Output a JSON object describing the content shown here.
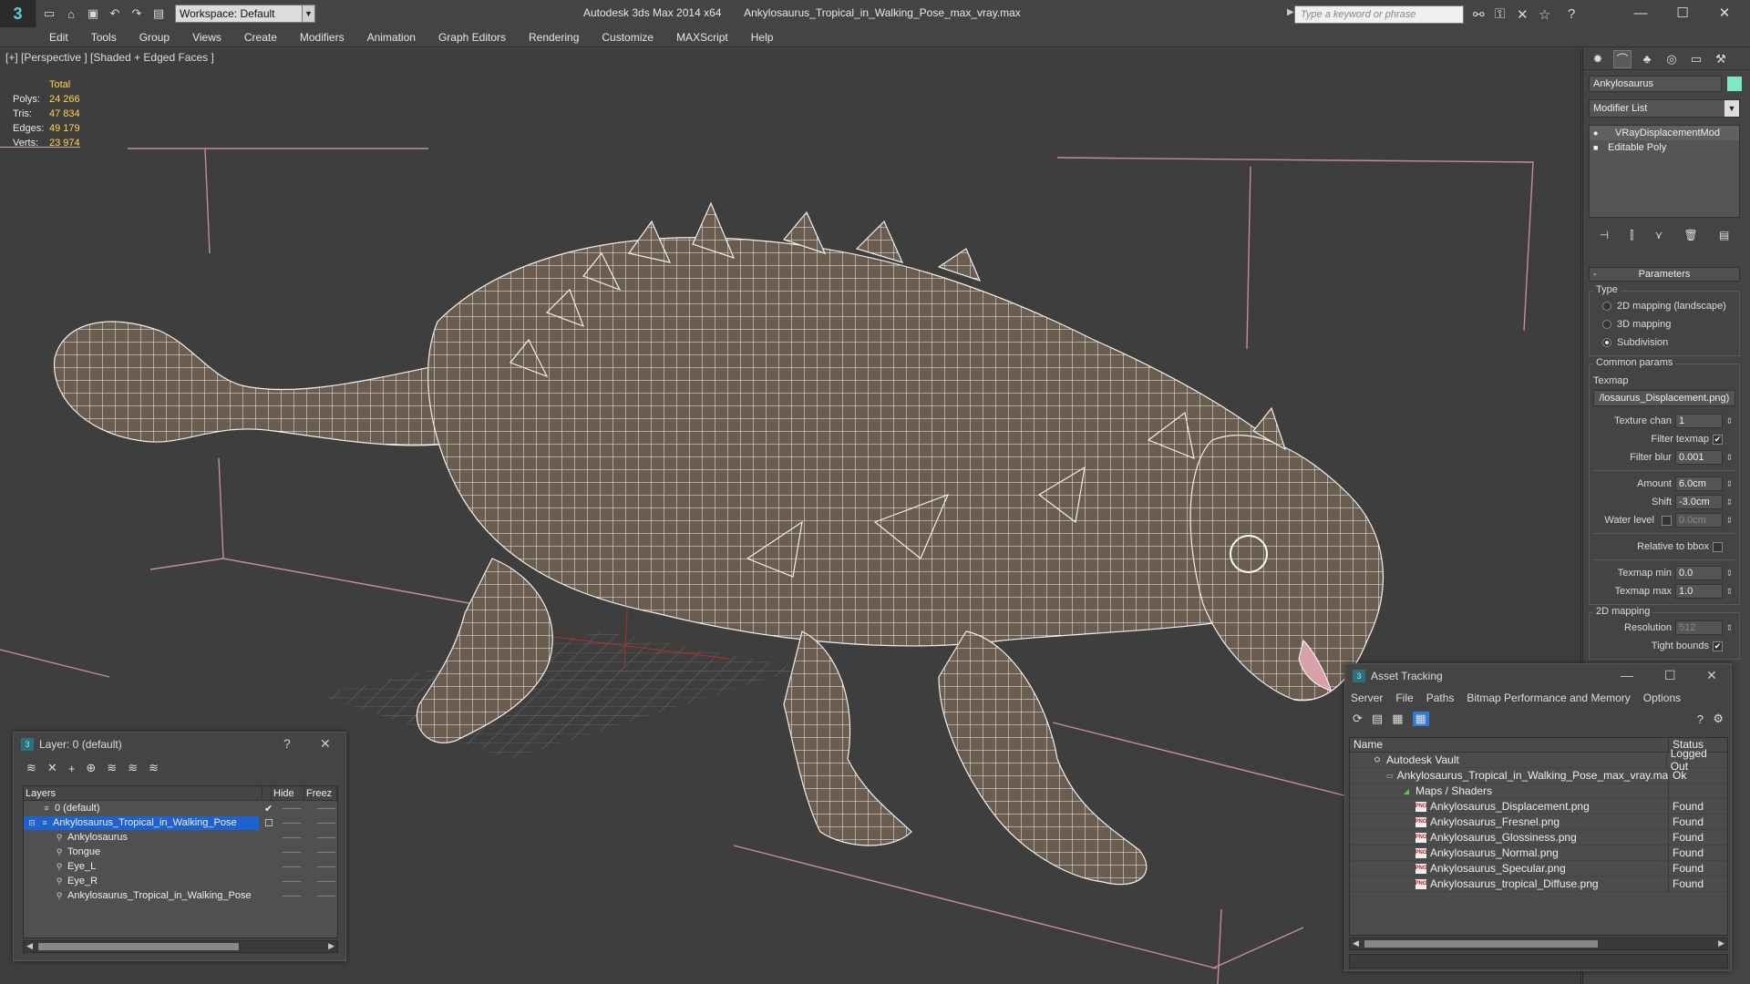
{
  "titlebar": {
    "workspace": "Workspace: Default",
    "app": "Autodesk 3ds Max  2014 x64",
    "file": "Ankylosaurus_Tropical_in_Walking_Pose_max_vray.max",
    "search_placeholder": "Type a keyword or phrase"
  },
  "menu": [
    "Edit",
    "Tools",
    "Group",
    "Views",
    "Create",
    "Modifiers",
    "Animation",
    "Graph Editors",
    "Rendering",
    "Customize",
    "MAXScript",
    "Help"
  ],
  "viewport": {
    "label": "[+] [Perspective ] [Shaded + Edged Faces ]",
    "stats": {
      "total_label": "Total",
      "rows": [
        {
          "k": "Polys:",
          "v": "24 266"
        },
        {
          "k": "Tris:",
          "v": "47 834"
        },
        {
          "k": "Edges:",
          "v": "49 179"
        },
        {
          "k": "Verts:",
          "v": "23 974"
        }
      ]
    }
  },
  "command_panel": {
    "object_name": "Ankylosaurus",
    "object_color": "#7de8c8",
    "modifier_list": "Modifier List",
    "stack": [
      "VRayDisplacementMod",
      "Editable Poly"
    ],
    "parameters_title": "Parameters",
    "type_group": "Type",
    "type_options": [
      "2D mapping (landscape)",
      "3D mapping",
      "Subdivision"
    ],
    "common_group": "Common params",
    "texmap_label": "Texmap",
    "texmap_value": "/losaurus_Displacement.png)",
    "texture_chan_label": "Texture chan",
    "texture_chan": "1",
    "filter_texmap_label": "Filter texmap",
    "filter_blur_label": "Filter blur",
    "filter_blur": "0.001",
    "amount_label": "Amount",
    "amount": "6.0cm",
    "shift_label": "Shift",
    "shift": "-3.0cm",
    "water_level_label": "Water level",
    "water_level": "0.0cm",
    "relative_bbox_label": "Relative to bbox",
    "texmap_min_label": "Texmap min",
    "texmap_min": "0.0",
    "texmap_max_label": "Texmap max",
    "texmap_max": "1.0",
    "mapping_group": "2D mapping",
    "resolution_label": "Resolution",
    "resolution": "512",
    "tight_bounds_label": "Tight bounds"
  },
  "layer_dialog": {
    "title": "Layer: 0 (default)",
    "help": "?",
    "close": "✕",
    "col_layers": "Layers",
    "col_hide": "Hide",
    "col_freeze": "Freez",
    "rows": [
      {
        "name": "0 (default)",
        "indent": 0
      },
      {
        "name": "Ankylosaurus_Tropical_in_Walking_Pose",
        "indent": 0
      },
      {
        "name": "Ankylosaurus",
        "indent": 1
      },
      {
        "name": "Tongue",
        "indent": 1
      },
      {
        "name": "Eye_L",
        "indent": 1
      },
      {
        "name": "Eye_R",
        "indent": 1
      },
      {
        "name": "Ankylosaurus_Tropical_in_Walking_Pose",
        "indent": 1
      }
    ],
    "current_mark": "✔",
    "dash": "——"
  },
  "asset_dialog": {
    "title": "Asset Tracking",
    "menu": [
      "Server",
      "File",
      "Paths",
      "Bitmap Performance and Memory",
      "Options"
    ],
    "col_name": "Name",
    "col_status": "Status",
    "rows": [
      {
        "name": "Autodesk Vault",
        "status": "Logged Out",
        "indent": 1,
        "icon": "vault"
      },
      {
        "name": "Ankylosaurus_Tropical_in_Walking_Pose_max_vray.max",
        "status": "Ok",
        "indent": 2,
        "icon": "doc"
      },
      {
        "name": "Maps / Shaders",
        "status": "",
        "indent": 3,
        "icon": "fold"
      },
      {
        "name": "Ankylosaurus_Displacement.png",
        "status": "Found",
        "indent": 4,
        "icon": "png"
      },
      {
        "name": "Ankylosaurus_Fresnel.png",
        "status": "Found",
        "indent": 4,
        "icon": "png"
      },
      {
        "name": "Ankylosaurus_Glossiness.png",
        "status": "Found",
        "indent": 4,
        "icon": "png"
      },
      {
        "name": "Ankylosaurus_Normal.png",
        "status": "Found",
        "indent": 4,
        "icon": "png"
      },
      {
        "name": "Ankylosaurus_Specular.png",
        "status": "Found",
        "indent": 4,
        "icon": "png"
      },
      {
        "name": "Ankylosaurus_tropical_Diffuse.png",
        "status": "Found",
        "indent": 4,
        "icon": "png"
      }
    ]
  }
}
